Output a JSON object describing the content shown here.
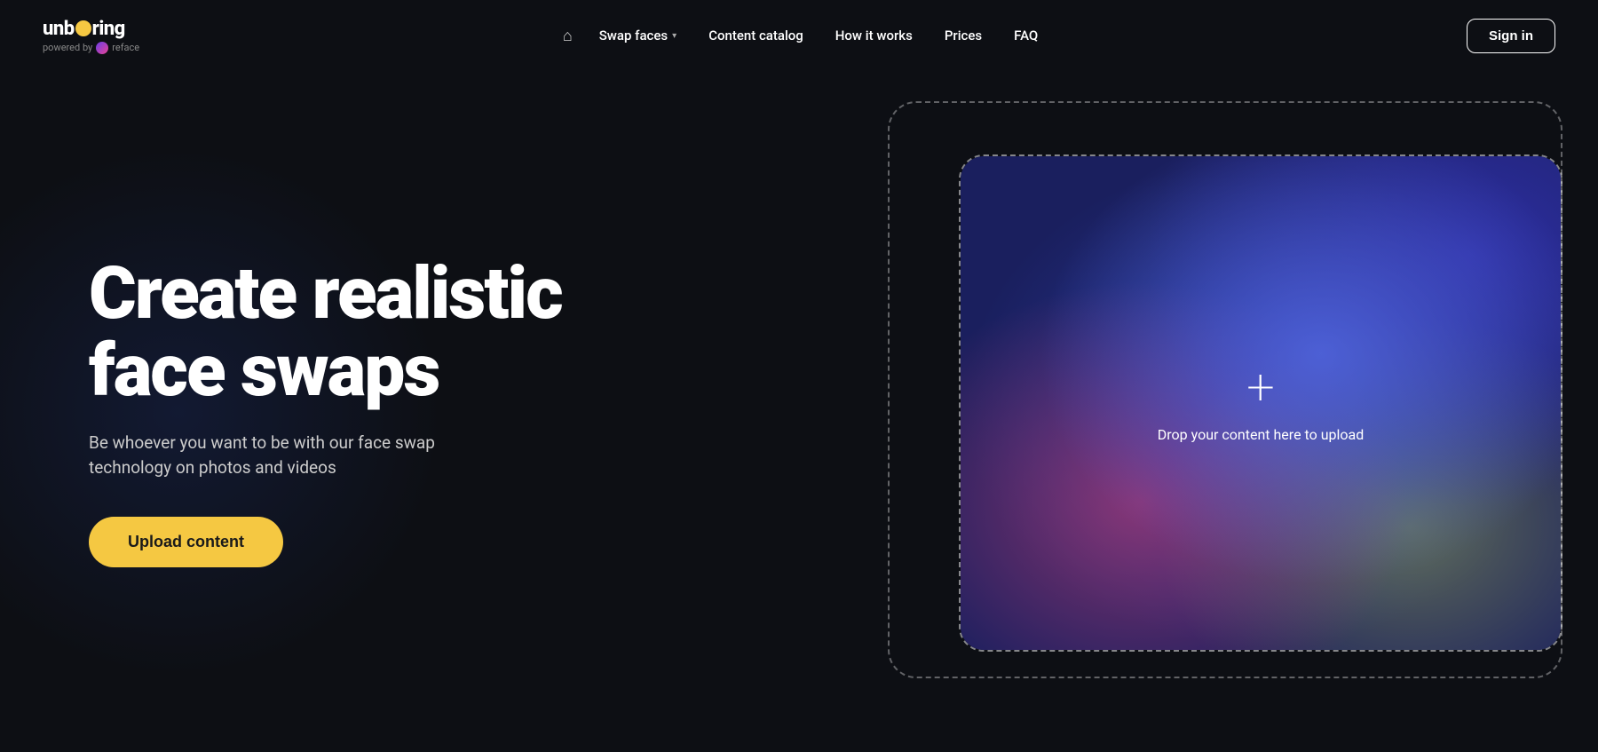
{
  "brand": {
    "name_part1": "unb",
    "name_part2": "ring",
    "powered_by": "powered by",
    "reface": "reface"
  },
  "navbar": {
    "home_icon": "⌂",
    "links": [
      {
        "label": "Swap faces",
        "has_dropdown": true,
        "id": "swap-faces"
      },
      {
        "label": "Content catalog",
        "has_dropdown": false,
        "id": "content-catalog"
      },
      {
        "label": "How it works",
        "has_dropdown": false,
        "id": "how-it-works"
      },
      {
        "label": "Prices",
        "has_dropdown": false,
        "id": "prices"
      },
      {
        "label": "FAQ",
        "has_dropdown": false,
        "id": "faq"
      }
    ],
    "signin_label": "Sign in"
  },
  "hero": {
    "title_line1": "Create realistic",
    "title_line2": "face swaps",
    "subtitle": "Be whoever you want to be with our face swap technology on photos and videos",
    "upload_button": "Upload content",
    "drop_text": "Drop your content here to upload",
    "plus_icon": "+"
  }
}
